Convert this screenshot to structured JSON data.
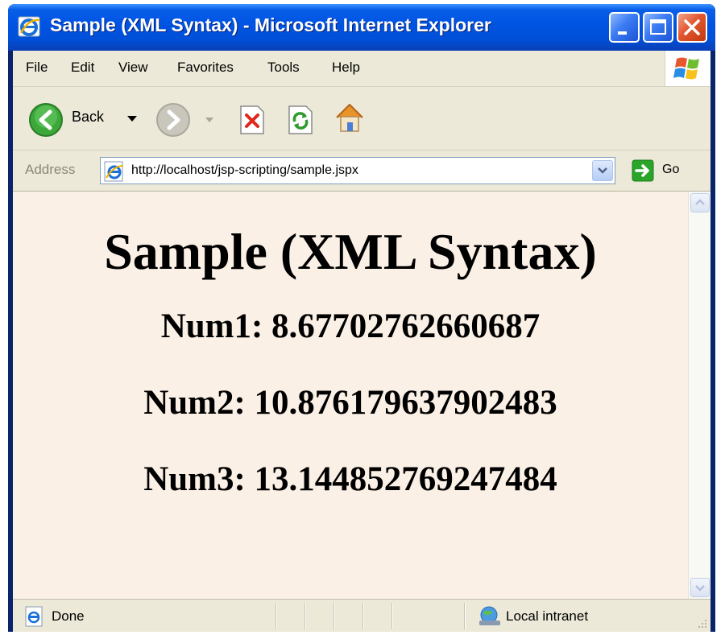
{
  "window": {
    "title": "Sample (XML Syntax) - Microsoft Internet Explorer",
    "controls": [
      "minimize",
      "maximize",
      "close"
    ]
  },
  "menubar": {
    "items": [
      "File",
      "Edit",
      "View",
      "Favorites",
      "Tools",
      "Help"
    ]
  },
  "toolbar": {
    "back_label": "Back",
    "icons": [
      "back-arrow-icon",
      "forward-arrow-icon",
      "stop-icon",
      "refresh-icon",
      "home-icon"
    ]
  },
  "addressbar": {
    "label": "Address",
    "url": "http://localhost/jsp-scripting/sample.jspx",
    "go_label": "Go"
  },
  "page": {
    "heading": "Sample (XML Syntax)",
    "lines": [
      "Num1: 8.67702762660687",
      "Num2: 10.876179637902483",
      "Num3: 13.144852769247484"
    ],
    "background": "#faf0e6"
  },
  "statusbar": {
    "status": "Done",
    "zone": "Local intranet"
  },
  "colors": {
    "titlebar": "#0054e3",
    "chrome": "#ece9d8",
    "close_button": "#e2562f"
  }
}
